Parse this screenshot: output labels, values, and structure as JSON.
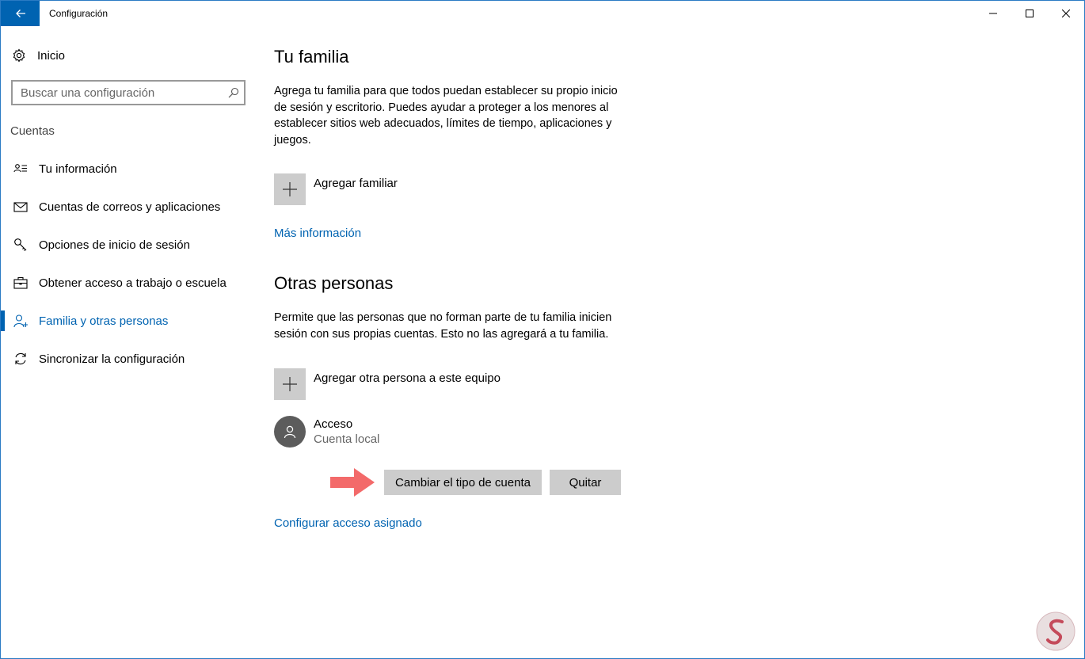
{
  "window": {
    "title": "Configuración",
    "controls": [
      "minimize",
      "maximize",
      "close"
    ]
  },
  "sidebar": {
    "home_label": "Inicio",
    "search": {
      "placeholder": "Buscar una configuración",
      "value": ""
    },
    "section_label": "Cuentas",
    "items": [
      {
        "label": "Tu información",
        "icon": "contact-card-icon",
        "active": false
      },
      {
        "label": "Cuentas de correos y aplicaciones",
        "icon": "mail-icon",
        "active": false
      },
      {
        "label": "Opciones de inicio de sesión",
        "icon": "key-icon",
        "active": false
      },
      {
        "label": "Obtener acceso a trabajo o escuela",
        "icon": "briefcase-icon",
        "active": false
      },
      {
        "label": "Familia y otras personas",
        "icon": "add-person-icon",
        "active": true
      },
      {
        "label": "Sincronizar la configuración",
        "icon": "sync-icon",
        "active": false
      }
    ]
  },
  "main": {
    "family": {
      "heading": "Tu familia",
      "description": "Agrega tu familia para que todos puedan establecer su propio inicio de sesión y escritorio. Puedes ayudar a proteger a los menores al establecer sitios web adecuados, límites de tiempo, aplicaciones y juegos.",
      "add_label": "Agregar familiar",
      "more_info_link": "Más información"
    },
    "others": {
      "heading": "Otras personas",
      "description": "Permite que las personas que no forman parte de tu familia inicien sesión con sus propias cuentas. Esto no las agregará a tu familia.",
      "add_label": "Agregar otra persona a este equipo",
      "user": {
        "name": "Acceso",
        "type": "Cuenta local"
      },
      "change_button": "Cambiar el tipo de cuenta",
      "remove_button": "Quitar",
      "assigned_access_link": "Configurar acceso asignado"
    }
  },
  "colors": {
    "accent": "#0063b1",
    "button_gray": "#cccccc",
    "arrow": "#f36a6a",
    "avatar": "#5c5c5c"
  }
}
